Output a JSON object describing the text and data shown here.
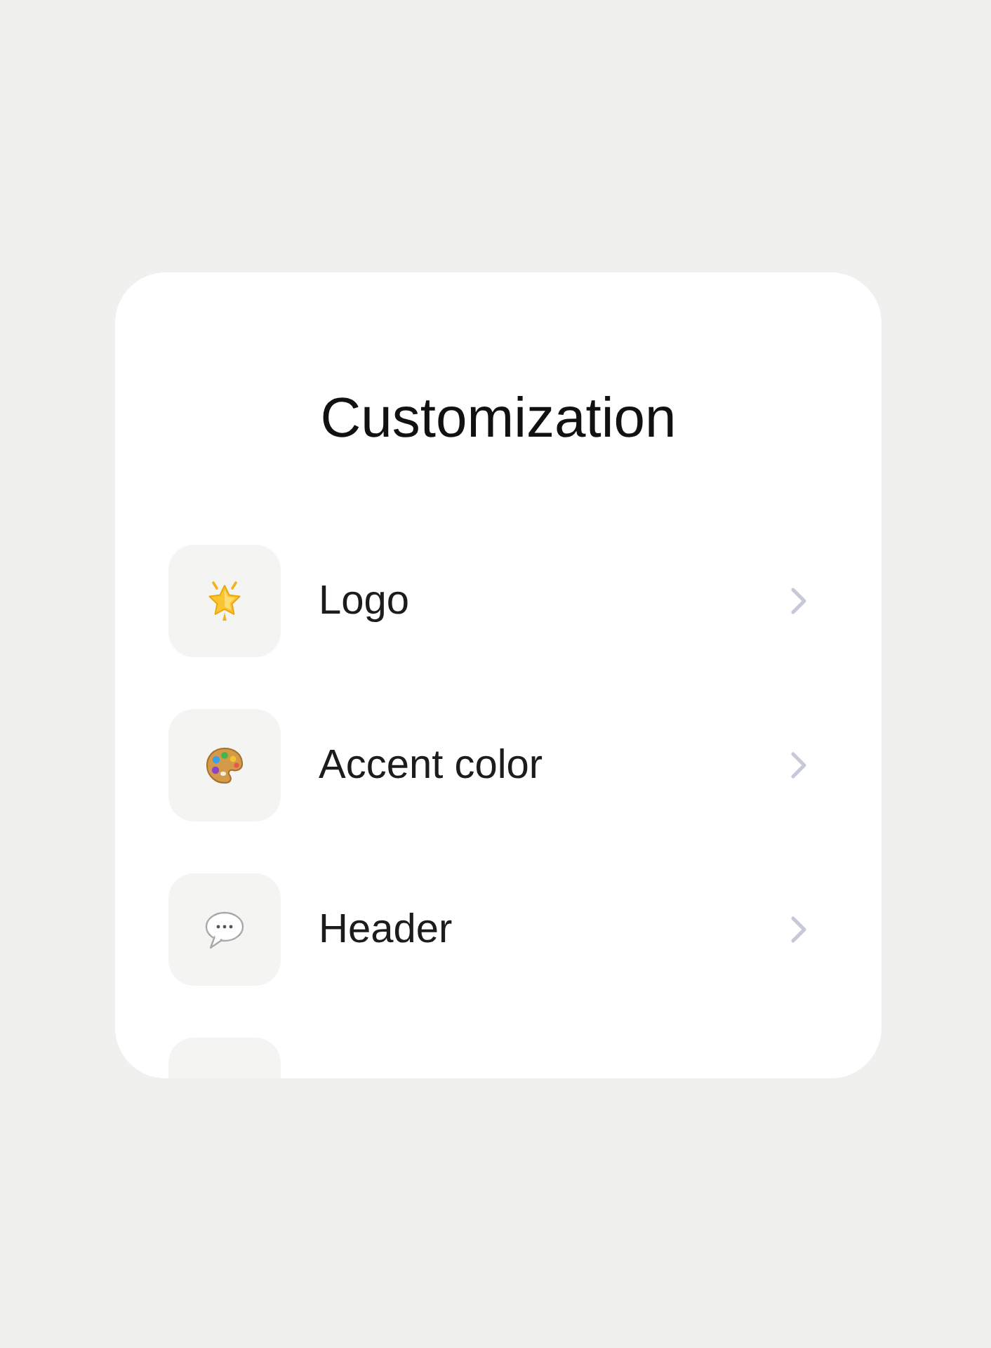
{
  "card": {
    "title": "Customization",
    "items": [
      {
        "kind": "option",
        "label": "Logo"
      },
      {
        "kind": "option",
        "label": "Accent color"
      },
      {
        "kind": "option",
        "label": "Header"
      },
      {
        "kind": "clipped"
      }
    ]
  }
}
